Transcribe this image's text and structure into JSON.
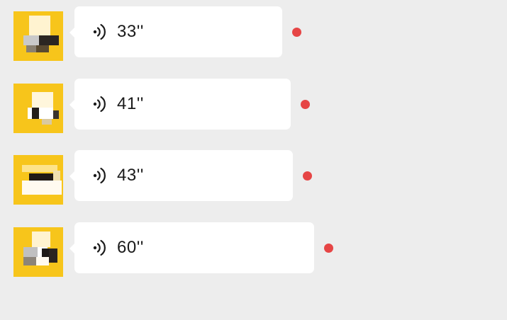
{
  "colors": {
    "background": "#ededed",
    "bubble": "#ffffff",
    "unread_dot": "#e64545",
    "avatar_yellow": "#f7c51b"
  },
  "messages": [
    {
      "duration": "33''",
      "unread": true,
      "icon": "voice-wave-icon"
    },
    {
      "duration": "41''",
      "unread": true,
      "icon": "voice-wave-icon"
    },
    {
      "duration": "43''",
      "unread": true,
      "icon": "voice-wave-icon"
    },
    {
      "duration": "60''",
      "unread": true,
      "icon": "voice-wave-icon"
    }
  ]
}
